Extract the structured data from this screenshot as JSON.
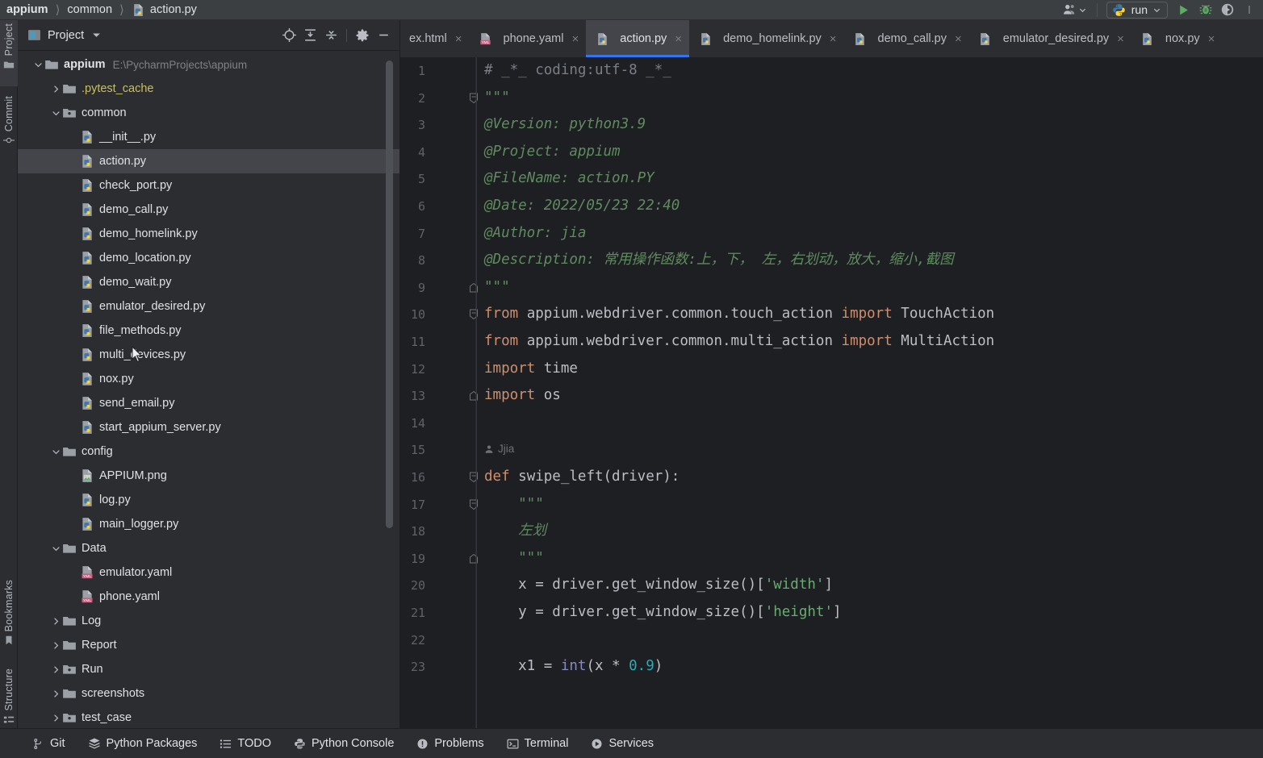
{
  "app": {
    "breadcrumb": [
      {
        "label": "appium",
        "icon": "none",
        "bold": true
      },
      {
        "label": "common",
        "icon": "none",
        "bold": false
      },
      {
        "label": "action.py",
        "icon": "python-file-icon",
        "bold": false
      }
    ],
    "run_config_label": "run",
    "toolbar_icons": [
      "user-account-icon",
      "run-icon",
      "debug-icon",
      "run-with-coverage-icon",
      "more-icon"
    ]
  },
  "stripe": {
    "top": [
      {
        "label": "Project",
        "icon": "project-icon",
        "active": true
      },
      {
        "label": "Commit",
        "icon": "commit-icon",
        "active": false
      }
    ],
    "bottom": [
      {
        "label": "Bookmarks",
        "icon": "bookmarks-icon",
        "active": false
      },
      {
        "label": "Structure",
        "icon": "structure-icon",
        "active": false
      }
    ]
  },
  "project_panel": {
    "title": "Project",
    "header_icons": [
      "locate-icon",
      "expand-all-icon",
      "collapse-all-icon",
      "settings-gear-icon",
      "hide-icon"
    ],
    "tree": [
      {
        "depth": 0,
        "label": "appium",
        "hint": "E:\\PycharmProjects\\appium",
        "icon": "folder-icon",
        "arrow": "down",
        "bold": true,
        "selected": false
      },
      {
        "depth": 1,
        "label": ".pytest_cache",
        "hint": "",
        "icon": "folder-icon",
        "arrow": "right",
        "bold": false,
        "selected": false,
        "muted": true
      },
      {
        "depth": 1,
        "label": "common",
        "hint": "",
        "icon": "folder-source-icon",
        "arrow": "down",
        "bold": false,
        "selected": false
      },
      {
        "depth": 2,
        "label": "__init__.py",
        "hint": "",
        "icon": "python-file-icon",
        "arrow": "none",
        "bold": false,
        "selected": false
      },
      {
        "depth": 2,
        "label": "action.py",
        "hint": "",
        "icon": "python-file-icon",
        "arrow": "none",
        "bold": false,
        "selected": true
      },
      {
        "depth": 2,
        "label": "check_port.py",
        "hint": "",
        "icon": "python-file-icon",
        "arrow": "none",
        "bold": false,
        "selected": false
      },
      {
        "depth": 2,
        "label": "demo_call.py",
        "hint": "",
        "icon": "python-file-icon",
        "arrow": "none",
        "bold": false,
        "selected": false
      },
      {
        "depth": 2,
        "label": "demo_homelink.py",
        "hint": "",
        "icon": "python-file-icon",
        "arrow": "none",
        "bold": false,
        "selected": false
      },
      {
        "depth": 2,
        "label": "demo_location.py",
        "hint": "",
        "icon": "python-file-icon",
        "arrow": "none",
        "bold": false,
        "selected": false
      },
      {
        "depth": 2,
        "label": "demo_wait.py",
        "hint": "",
        "icon": "python-file-icon",
        "arrow": "none",
        "bold": false,
        "selected": false
      },
      {
        "depth": 2,
        "label": "emulator_desired.py",
        "hint": "",
        "icon": "python-file-icon",
        "arrow": "none",
        "bold": false,
        "selected": false
      },
      {
        "depth": 2,
        "label": "file_methods.py",
        "hint": "",
        "icon": "python-file-icon",
        "arrow": "none",
        "bold": false,
        "selected": false
      },
      {
        "depth": 2,
        "label": "multi_devices.py",
        "hint": "",
        "icon": "python-file-icon",
        "arrow": "none",
        "bold": false,
        "selected": false
      },
      {
        "depth": 2,
        "label": "nox.py",
        "hint": "",
        "icon": "python-file-icon",
        "arrow": "none",
        "bold": false,
        "selected": false
      },
      {
        "depth": 2,
        "label": "send_email.py",
        "hint": "",
        "icon": "python-file-icon",
        "arrow": "none",
        "bold": false,
        "selected": false
      },
      {
        "depth": 2,
        "label": "start_appium_server.py",
        "hint": "",
        "icon": "python-file-icon",
        "arrow": "none",
        "bold": false,
        "selected": false
      },
      {
        "depth": 1,
        "label": "config",
        "hint": "",
        "icon": "folder-icon",
        "arrow": "down",
        "bold": false,
        "selected": false
      },
      {
        "depth": 2,
        "label": "APPIUM.png",
        "hint": "",
        "icon": "image-file-icon",
        "arrow": "none",
        "bold": false,
        "selected": false
      },
      {
        "depth": 2,
        "label": "log.py",
        "hint": "",
        "icon": "python-file-icon",
        "arrow": "none",
        "bold": false,
        "selected": false
      },
      {
        "depth": 2,
        "label": "main_logger.py",
        "hint": "",
        "icon": "python-file-icon",
        "arrow": "none",
        "bold": false,
        "selected": false
      },
      {
        "depth": 1,
        "label": "Data",
        "hint": "",
        "icon": "folder-icon",
        "arrow": "down",
        "bold": false,
        "selected": false
      },
      {
        "depth": 2,
        "label": "emulator.yaml",
        "hint": "",
        "icon": "yaml-file-icon",
        "arrow": "none",
        "bold": false,
        "selected": false
      },
      {
        "depth": 2,
        "label": "phone.yaml",
        "hint": "",
        "icon": "yaml-file-icon",
        "arrow": "none",
        "bold": false,
        "selected": false
      },
      {
        "depth": 1,
        "label": "Log",
        "hint": "",
        "icon": "folder-icon",
        "arrow": "right",
        "bold": false,
        "selected": false
      },
      {
        "depth": 1,
        "label": "Report",
        "hint": "",
        "icon": "folder-icon",
        "arrow": "right",
        "bold": false,
        "selected": false
      },
      {
        "depth": 1,
        "label": "Run",
        "hint": "",
        "icon": "folder-source-icon",
        "arrow": "right",
        "bold": false,
        "selected": false
      },
      {
        "depth": 1,
        "label": "screenshots",
        "hint": "",
        "icon": "folder-icon",
        "arrow": "right",
        "bold": false,
        "selected": false
      },
      {
        "depth": 1,
        "label": "test_case",
        "hint": "",
        "icon": "folder-source-icon",
        "arrow": "right",
        "bold": false,
        "selected": false
      }
    ]
  },
  "editor": {
    "tabs": [
      {
        "label": "ex.html",
        "icon": "html-file-icon",
        "active": false,
        "clipped": true
      },
      {
        "label": "phone.yaml",
        "icon": "yaml-file-icon",
        "active": false,
        "clipped": false
      },
      {
        "label": "action.py",
        "icon": "python-file-icon",
        "active": true,
        "clipped": false
      },
      {
        "label": "demo_homelink.py",
        "icon": "python-file-icon",
        "active": false,
        "clipped": false
      },
      {
        "label": "demo_call.py",
        "icon": "python-file-icon",
        "active": false,
        "clipped": false
      },
      {
        "label": "emulator_desired.py",
        "icon": "python-file-icon",
        "active": false,
        "clipped": false
      },
      {
        "label": "nox.py",
        "icon": "python-file-icon",
        "active": false,
        "clipped": false
      }
    ],
    "inlay_hint": "Jjia",
    "lines": [
      {
        "n": 1,
        "fold": "none",
        "tokens": [
          {
            "t": "# _*_ coding:utf-8 _*_",
            "c": "c-comment"
          }
        ]
      },
      {
        "n": 2,
        "fold": "open",
        "tokens": [
          {
            "t": "\"\"\"",
            "c": "c-doc"
          }
        ]
      },
      {
        "n": 3,
        "fold": "none",
        "tokens": [
          {
            "t": "@Version: python3.9",
            "c": "c-doc"
          }
        ]
      },
      {
        "n": 4,
        "fold": "none",
        "tokens": [
          {
            "t": "@Project: appium",
            "c": "c-doc"
          }
        ]
      },
      {
        "n": 5,
        "fold": "none",
        "tokens": [
          {
            "t": "@FileName: action.PY",
            "c": "c-doc"
          }
        ]
      },
      {
        "n": 6,
        "fold": "none",
        "tokens": [
          {
            "t": "@Date: 2022/05/23 22:40",
            "c": "c-doc"
          }
        ]
      },
      {
        "n": 7,
        "fold": "none",
        "tokens": [
          {
            "t": "@Author: jia",
            "c": "c-doc"
          }
        ]
      },
      {
        "n": 8,
        "fold": "none",
        "tokens": [
          {
            "t": "@Description: 常用操作函数:上，下， 左，右划动，放大，缩小,截图",
            "c": "c-doc"
          }
        ]
      },
      {
        "n": 9,
        "fold": "close",
        "tokens": [
          {
            "t": "\"\"\"",
            "c": "c-doc"
          }
        ]
      },
      {
        "n": 10,
        "fold": "open",
        "tokens": [
          {
            "t": "from",
            "c": "c-kw"
          },
          {
            "t": " appium.webdriver.common.touch_action ",
            "c": "c-plain"
          },
          {
            "t": "import",
            "c": "c-kw"
          },
          {
            "t": " TouchAction",
            "c": "c-plain"
          }
        ]
      },
      {
        "n": 11,
        "fold": "none",
        "tokens": [
          {
            "t": "from",
            "c": "c-kw"
          },
          {
            "t": " appium.webdriver.common.multi_action ",
            "c": "c-plain"
          },
          {
            "t": "import",
            "c": "c-kw"
          },
          {
            "t": " MultiAction",
            "c": "c-plain"
          }
        ]
      },
      {
        "n": 12,
        "fold": "none",
        "tokens": [
          {
            "t": "import",
            "c": "c-kw"
          },
          {
            "t": " time",
            "c": "c-plain"
          }
        ]
      },
      {
        "n": 13,
        "fold": "close",
        "tokens": [
          {
            "t": "import",
            "c": "c-kw"
          },
          {
            "t": " os",
            "c": "c-plain"
          }
        ]
      },
      {
        "n": 14,
        "fold": "none",
        "tokens": []
      },
      {
        "n": 15,
        "fold": "none",
        "tokens": []
      },
      {
        "n": 16,
        "fold": "open",
        "tokens": [
          {
            "t": "def",
            "c": "c-kw"
          },
          {
            "t": " ",
            "c": "c-plain"
          },
          {
            "t": "swipe_left",
            "c": "c-def"
          },
          {
            "t": "(driver):",
            "c": "c-plain"
          }
        ]
      },
      {
        "n": 17,
        "fold": "open2",
        "tokens": [
          {
            "t": "    \"\"\"",
            "c": "c-doc"
          }
        ]
      },
      {
        "n": 18,
        "fold": "none",
        "tokens": [
          {
            "t": "    左划",
            "c": "c-doc"
          }
        ]
      },
      {
        "n": 19,
        "fold": "close2",
        "tokens": [
          {
            "t": "    \"\"\"",
            "c": "c-doc"
          }
        ]
      },
      {
        "n": 20,
        "fold": "none",
        "tokens": [
          {
            "t": "    x = driver.get_window_size()[",
            "c": "c-plain"
          },
          {
            "t": "'width'",
            "c": "c-str"
          },
          {
            "t": "]",
            "c": "c-plain"
          }
        ]
      },
      {
        "n": 21,
        "fold": "none",
        "tokens": [
          {
            "t": "    y = driver.get_window_size()[",
            "c": "c-plain"
          },
          {
            "t": "'height'",
            "c": "c-str"
          },
          {
            "t": "]",
            "c": "c-plain"
          }
        ]
      },
      {
        "n": 22,
        "fold": "none",
        "tokens": []
      },
      {
        "n": 23,
        "fold": "none",
        "tokens": [
          {
            "t": "    x1 = ",
            "c": "c-plain"
          },
          {
            "t": "int",
            "c": "c-builtin"
          },
          {
            "t": "(x * ",
            "c": "c-plain"
          },
          {
            "t": "0.9",
            "c": "c-num"
          },
          {
            "t": ")",
            "c": "c-plain"
          }
        ]
      }
    ]
  },
  "statusbar": {
    "items": [
      {
        "label": "Git",
        "icon": "git-branch-icon"
      },
      {
        "label": "Python Packages",
        "icon": "packages-icon"
      },
      {
        "label": "TODO",
        "icon": "todo-list-icon"
      },
      {
        "label": "Python Console",
        "icon": "python-console-icon"
      },
      {
        "label": "Problems",
        "icon": "problems-icon"
      },
      {
        "label": "Terminal",
        "icon": "terminal-icon"
      },
      {
        "label": "Services",
        "icon": "services-icon"
      }
    ]
  },
  "colors": {
    "accent_blue": "#3574f0",
    "bg_panel": "#2b2d30",
    "bg_editor": "#1e1f22",
    "selection": "#43454a",
    "text": "#dfe1e5"
  }
}
